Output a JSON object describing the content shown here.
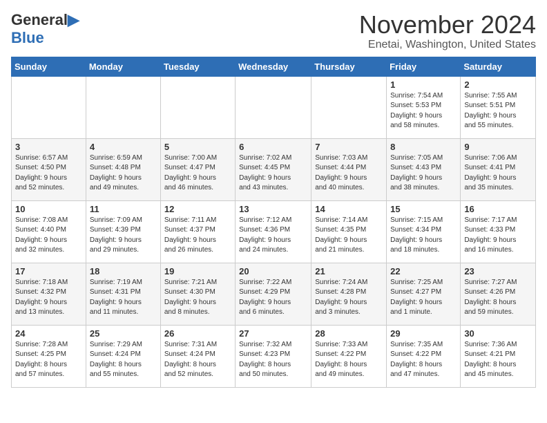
{
  "header": {
    "logo_general": "General",
    "logo_blue": "Blue",
    "month_title": "November 2024",
    "location": "Enetai, Washington, United States"
  },
  "days_of_week": [
    "Sunday",
    "Monday",
    "Tuesday",
    "Wednesday",
    "Thursday",
    "Friday",
    "Saturday"
  ],
  "weeks": [
    [
      {
        "day": "",
        "info": ""
      },
      {
        "day": "",
        "info": ""
      },
      {
        "day": "",
        "info": ""
      },
      {
        "day": "",
        "info": ""
      },
      {
        "day": "",
        "info": ""
      },
      {
        "day": "1",
        "info": "Sunrise: 7:54 AM\nSunset: 5:53 PM\nDaylight: 9 hours\nand 58 minutes."
      },
      {
        "day": "2",
        "info": "Sunrise: 7:55 AM\nSunset: 5:51 PM\nDaylight: 9 hours\nand 55 minutes."
      }
    ],
    [
      {
        "day": "3",
        "info": "Sunrise: 6:57 AM\nSunset: 4:50 PM\nDaylight: 9 hours\nand 52 minutes."
      },
      {
        "day": "4",
        "info": "Sunrise: 6:59 AM\nSunset: 4:48 PM\nDaylight: 9 hours\nand 49 minutes."
      },
      {
        "day": "5",
        "info": "Sunrise: 7:00 AM\nSunset: 4:47 PM\nDaylight: 9 hours\nand 46 minutes."
      },
      {
        "day": "6",
        "info": "Sunrise: 7:02 AM\nSunset: 4:45 PM\nDaylight: 9 hours\nand 43 minutes."
      },
      {
        "day": "7",
        "info": "Sunrise: 7:03 AM\nSunset: 4:44 PM\nDaylight: 9 hours\nand 40 minutes."
      },
      {
        "day": "8",
        "info": "Sunrise: 7:05 AM\nSunset: 4:43 PM\nDaylight: 9 hours\nand 38 minutes."
      },
      {
        "day": "9",
        "info": "Sunrise: 7:06 AM\nSunset: 4:41 PM\nDaylight: 9 hours\nand 35 minutes."
      }
    ],
    [
      {
        "day": "10",
        "info": "Sunrise: 7:08 AM\nSunset: 4:40 PM\nDaylight: 9 hours\nand 32 minutes."
      },
      {
        "day": "11",
        "info": "Sunrise: 7:09 AM\nSunset: 4:39 PM\nDaylight: 9 hours\nand 29 minutes."
      },
      {
        "day": "12",
        "info": "Sunrise: 7:11 AM\nSunset: 4:37 PM\nDaylight: 9 hours\nand 26 minutes."
      },
      {
        "day": "13",
        "info": "Sunrise: 7:12 AM\nSunset: 4:36 PM\nDaylight: 9 hours\nand 24 minutes."
      },
      {
        "day": "14",
        "info": "Sunrise: 7:14 AM\nSunset: 4:35 PM\nDaylight: 9 hours\nand 21 minutes."
      },
      {
        "day": "15",
        "info": "Sunrise: 7:15 AM\nSunset: 4:34 PM\nDaylight: 9 hours\nand 18 minutes."
      },
      {
        "day": "16",
        "info": "Sunrise: 7:17 AM\nSunset: 4:33 PM\nDaylight: 9 hours\nand 16 minutes."
      }
    ],
    [
      {
        "day": "17",
        "info": "Sunrise: 7:18 AM\nSunset: 4:32 PM\nDaylight: 9 hours\nand 13 minutes."
      },
      {
        "day": "18",
        "info": "Sunrise: 7:19 AM\nSunset: 4:31 PM\nDaylight: 9 hours\nand 11 minutes."
      },
      {
        "day": "19",
        "info": "Sunrise: 7:21 AM\nSunset: 4:30 PM\nDaylight: 9 hours\nand 8 minutes."
      },
      {
        "day": "20",
        "info": "Sunrise: 7:22 AM\nSunset: 4:29 PM\nDaylight: 9 hours\nand 6 minutes."
      },
      {
        "day": "21",
        "info": "Sunrise: 7:24 AM\nSunset: 4:28 PM\nDaylight: 9 hours\nand 3 minutes."
      },
      {
        "day": "22",
        "info": "Sunrise: 7:25 AM\nSunset: 4:27 PM\nDaylight: 9 hours\nand 1 minute."
      },
      {
        "day": "23",
        "info": "Sunrise: 7:27 AM\nSunset: 4:26 PM\nDaylight: 8 hours\nand 59 minutes."
      }
    ],
    [
      {
        "day": "24",
        "info": "Sunrise: 7:28 AM\nSunset: 4:25 PM\nDaylight: 8 hours\nand 57 minutes."
      },
      {
        "day": "25",
        "info": "Sunrise: 7:29 AM\nSunset: 4:24 PM\nDaylight: 8 hours\nand 55 minutes."
      },
      {
        "day": "26",
        "info": "Sunrise: 7:31 AM\nSunset: 4:24 PM\nDaylight: 8 hours\nand 52 minutes."
      },
      {
        "day": "27",
        "info": "Sunrise: 7:32 AM\nSunset: 4:23 PM\nDaylight: 8 hours\nand 50 minutes."
      },
      {
        "day": "28",
        "info": "Sunrise: 7:33 AM\nSunset: 4:22 PM\nDaylight: 8 hours\nand 49 minutes."
      },
      {
        "day": "29",
        "info": "Sunrise: 7:35 AM\nSunset: 4:22 PM\nDaylight: 8 hours\nand 47 minutes."
      },
      {
        "day": "30",
        "info": "Sunrise: 7:36 AM\nSunset: 4:21 PM\nDaylight: 8 hours\nand 45 minutes."
      }
    ]
  ]
}
